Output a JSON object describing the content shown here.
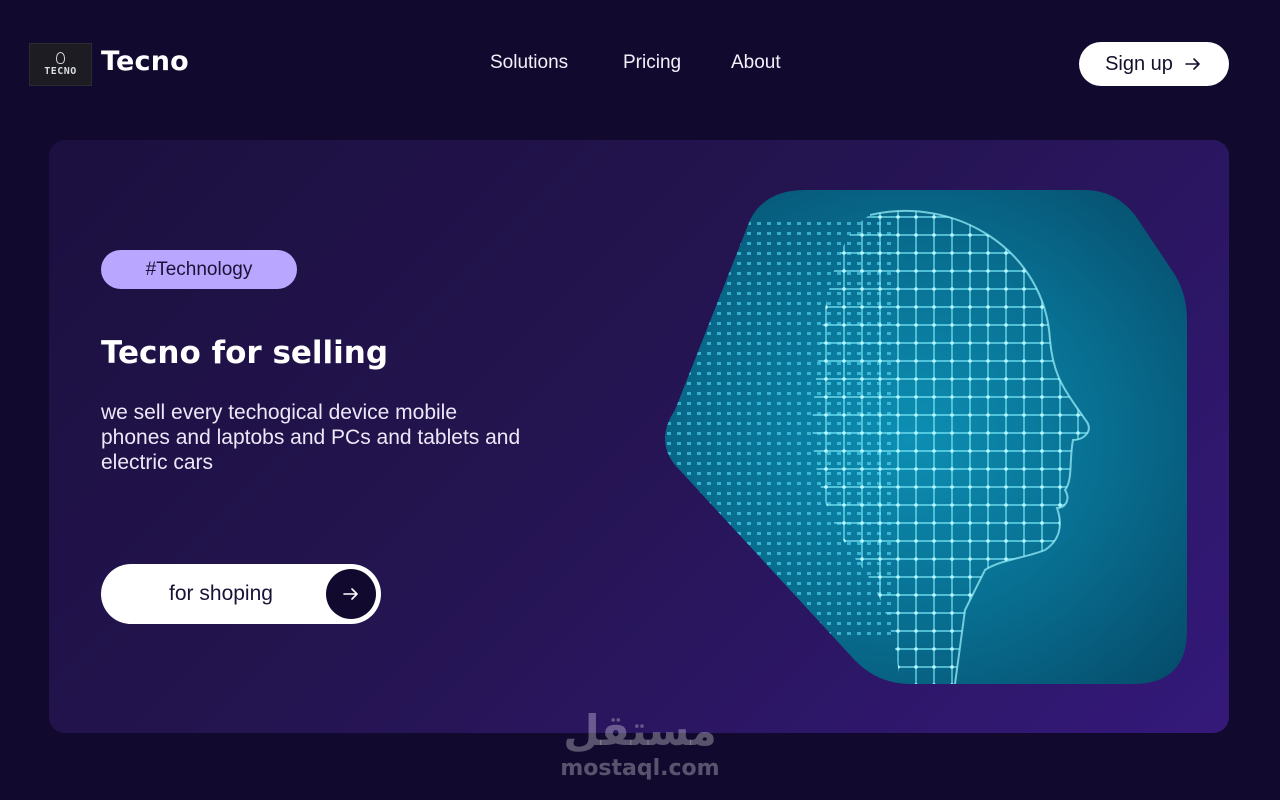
{
  "header": {
    "logo_text": "TECNO",
    "brand": "Tecno",
    "nav": [
      {
        "label": "Solutions"
      },
      {
        "label": "Pricing"
      },
      {
        "label": "About"
      }
    ],
    "signup_label": "Sign up"
  },
  "hero": {
    "tag": "#Technology",
    "title": "Tecno for selling",
    "description": "we sell every techogical device mobile phones and laptobs and PCs and tablets and electric cars",
    "cta_label": "for shoping",
    "image_icon": "ai-circuit-head-icon"
  },
  "watermark": {
    "arabic": "مستقل",
    "latin": "mostaql.com"
  },
  "colors": {
    "background": "#120a2e",
    "card_start": "#1b103f",
    "card_end": "#34197a",
    "tag": "#b9a6ff",
    "accent_cyan": "#3fd4f0"
  }
}
